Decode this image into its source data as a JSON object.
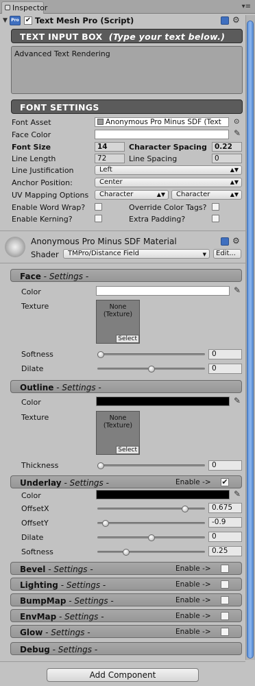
{
  "tab": {
    "title": "Inspector"
  },
  "component": {
    "title": "Text Mesh Pro (Script)",
    "enabled": true
  },
  "text_input": {
    "header": "TEXT INPUT BOX",
    "header_hint": "(Type your text below.)",
    "value": "Advanced Text Rendering"
  },
  "font_settings": {
    "header": "FONT SETTINGS",
    "font_asset_label": "Font Asset",
    "font_asset_value": "Anonymous Pro Minus SDF (Text",
    "face_color_label": "Face Color",
    "font_size_label": "Font Size",
    "font_size_value": "14",
    "char_spacing_label": "Character Spacing",
    "char_spacing_value": "0.22",
    "line_length_label": "Line Length",
    "line_length_value": "72",
    "line_spacing_label": "Line Spacing",
    "line_spacing_value": "0",
    "line_justification_label": "Line Justification",
    "line_justification_value": "Left",
    "anchor_label": "Anchor Position:",
    "anchor_value": "Center",
    "uv_label": "UV Mapping Options",
    "uv_value1": "Character",
    "uv_value2": "Character",
    "word_wrap_label": "Enable Word Wrap?",
    "override_color_label": "Override Color Tags?",
    "kerning_label": "Enable Kerning?",
    "extra_padding_label": "Extra Padding?"
  },
  "material": {
    "title": "Anonymous Pro Minus SDF Material",
    "shader_label": "Shader",
    "shader_value": "TMPro/Distance Field",
    "edit_label": "Edit..."
  },
  "face": {
    "title": "Face",
    "subtitle": "- Settings -",
    "color_label": "Color",
    "texture_label": "Texture",
    "texture_none": "None",
    "texture_type": "(Texture)",
    "select_label": "Select",
    "softness_label": "Softness",
    "softness_value": "0",
    "softness_level": 0.0,
    "dilate_label": "Dilate",
    "dilate_value": "0",
    "dilate_level": 0.5
  },
  "outline": {
    "title": "Outline",
    "subtitle": "- Settings -",
    "color_label": "Color",
    "texture_label": "Texture",
    "texture_none": "None",
    "texture_type": "(Texture)",
    "select_label": "Select",
    "thickness_label": "Thickness",
    "thickness_value": "0",
    "thickness_level": 0.0
  },
  "underlay": {
    "title": "Underlay",
    "subtitle": "- Settings -",
    "enable_label": "Enable ->",
    "enabled": true,
    "check_glyph": "✔",
    "color_label": "Color",
    "offsetx_label": "OffsetX",
    "offsetx_value": "0.675",
    "offsetx_level": 0.84,
    "offsety_label": "OffsetY",
    "offsety_value": "-0.9",
    "offsety_level": 0.05,
    "dilate_label": "Dilate",
    "dilate_value": "0",
    "dilate_level": 0.5,
    "softness_label": "Softness",
    "softness_value": "0.25",
    "softness_level": 0.25
  },
  "sections": [
    {
      "title": "Bevel",
      "subtitle": "- Settings -",
      "enable_label": "Enable ->"
    },
    {
      "title": "Lighting",
      "subtitle": "- Settings -",
      "enable_label": "Enable ->"
    },
    {
      "title": "BumpMap",
      "subtitle": "- Settings -",
      "enable_label": "Enable ->"
    },
    {
      "title": "EnvMap",
      "subtitle": "- Settings -",
      "enable_label": "Enable ->"
    },
    {
      "title": "Glow",
      "subtitle": "- Settings -",
      "enable_label": "Enable ->"
    }
  ],
  "debug": {
    "title": "Debug",
    "subtitle": "- Settings -"
  },
  "add_component_label": "Add Component"
}
